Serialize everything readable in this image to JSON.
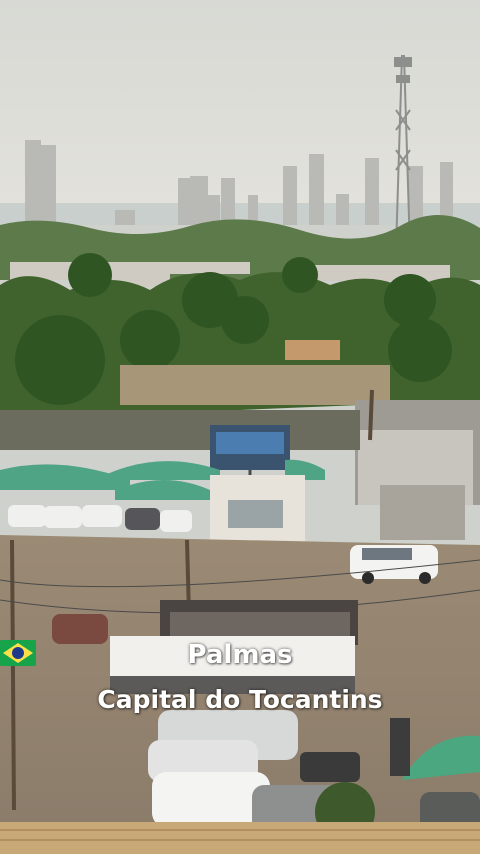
{
  "caption": {
    "line1": "Palmas",
    "line2": "Capital do Tocantins"
  },
  "flags": [
    "brazil-flag-icon",
    "brazil-flag-icon"
  ],
  "colors": {
    "sky": "#dcdcd6",
    "greenery": "#3f6b2d",
    "asphalt": "#8c7c6c",
    "canopy": "#4fa486",
    "flag_green": "#16a34a",
    "flag_yellow": "#fde047",
    "flag_blue": "#1e3a8a"
  }
}
